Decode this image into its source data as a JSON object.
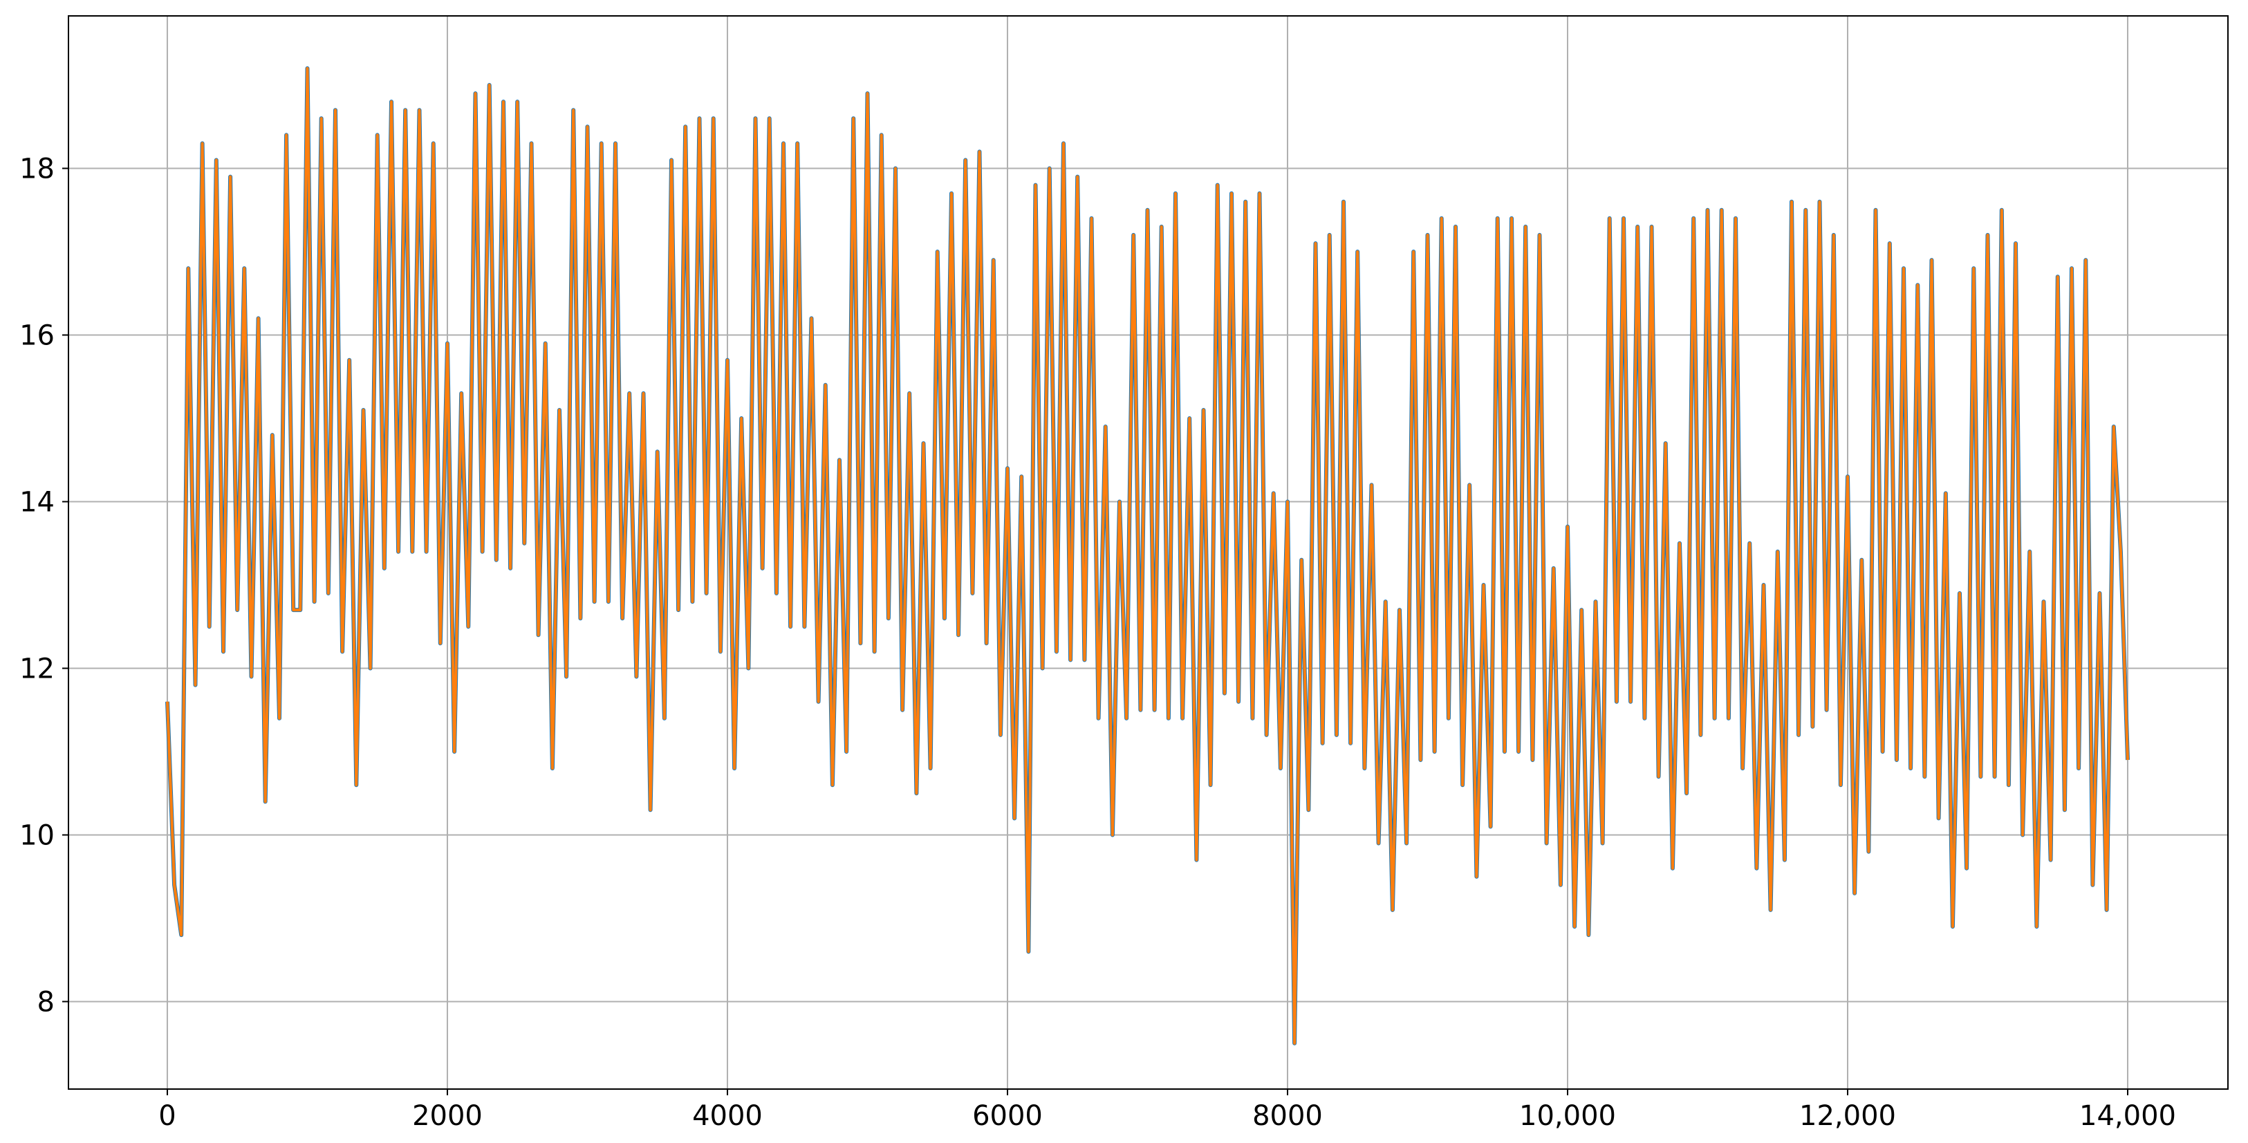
{
  "chart_data": {
    "type": "line",
    "title": "",
    "xlabel": "",
    "ylabel": "",
    "xlim": [
      -706,
      14716
    ],
    "ylim": [
      6.95,
      19.83
    ],
    "grid": true,
    "legend": "none",
    "x_start": 0,
    "x_step": 50,
    "x_ticks": [
      0,
      2000,
      4000,
      6000,
      8000,
      10000,
      12000,
      14000
    ],
    "x_tick_labels": [
      "0",
      "2000",
      "4000",
      "6000",
      "8000",
      "10,000",
      "12,000",
      "14,000"
    ],
    "y_ticks": [
      8,
      10,
      12,
      14,
      16,
      18
    ],
    "y_tick_labels": [
      "8",
      "10",
      "12",
      "14",
      "16",
      "18"
    ],
    "series": [
      {
        "name": "series-1",
        "color": "#1f77b4",
        "values": [
          11.6,
          9.4,
          8.8,
          16.8,
          11.8,
          18.3,
          12.5,
          18.1,
          12.2,
          17.9,
          12.7,
          16.8,
          11.9,
          16.2,
          10.4,
          14.8,
          11.4,
          18.4,
          12.7,
          12.7,
          19.2,
          12.8,
          18.6,
          12.9,
          18.7,
          12.2,
          15.7,
          10.6,
          15.1,
          12.0,
          18.4,
          13.2,
          18.8,
          13.4,
          18.7,
          13.4,
          18.7,
          13.4,
          18.3,
          12.3,
          15.9,
          11.0,
          15.3,
          12.5,
          18.9,
          13.4,
          19.0,
          13.3,
          18.8,
          13.2,
          18.8,
          13.5,
          18.3,
          12.4,
          15.9,
          10.8,
          15.1,
          11.9,
          18.7,
          12.6,
          18.5,
          12.8,
          18.3,
          12.8,
          18.3,
          12.6,
          15.3,
          11.9,
          15.3,
          10.3,
          14.6,
          11.4,
          18.1,
          12.7,
          18.5,
          12.8,
          18.6,
          12.9,
          18.6,
          12.2,
          15.7,
          10.8,
          15.0,
          12.0,
          18.6,
          13.2,
          18.6,
          12.9,
          18.3,
          12.5,
          18.3,
          12.5,
          16.2,
          11.6,
          15.4,
          10.6,
          14.5,
          11.0,
          18.6,
          12.3,
          18.9,
          12.2,
          18.4,
          12.6,
          18.0,
          11.5,
          15.3,
          10.5,
          14.7,
          10.8,
          17.0,
          12.6,
          17.7,
          12.4,
          18.1,
          12.9,
          18.2,
          12.3,
          16.9,
          11.2,
          14.4,
          10.2,
          14.3,
          8.6,
          17.8,
          12.0,
          18.0,
          12.2,
          18.3,
          12.1,
          17.9,
          12.1,
          17.4,
          11.4,
          14.9,
          10.0,
          14.0,
          11.4,
          17.2,
          11.5,
          17.5,
          11.5,
          17.3,
          11.4,
          17.7,
          11.4,
          15.0,
          9.7,
          15.1,
          10.6,
          17.8,
          11.7,
          17.7,
          11.6,
          17.6,
          11.4,
          17.7,
          11.2,
          14.1,
          10.8,
          14.0,
          7.5,
          13.3,
          10.3,
          17.1,
          11.1,
          17.2,
          11.2,
          17.6,
          11.1,
          17.0,
          10.8,
          14.2,
          9.9,
          12.8,
          9.1,
          12.7,
          9.9,
          17.0,
          10.9,
          17.2,
          11.0,
          17.4,
          11.4,
          17.3,
          10.6,
          14.2,
          9.5,
          13.0,
          10.1,
          17.4,
          11.0,
          17.4,
          11.0,
          17.3,
          10.9,
          17.2,
          9.9,
          13.2,
          9.4,
          13.7,
          8.9,
          12.7,
          8.8,
          12.8,
          9.9,
          17.4,
          11.6,
          17.4,
          11.6,
          17.3,
          11.4,
          17.3,
          10.7,
          14.7,
          9.6,
          13.5,
          10.5,
          17.4,
          11.2,
          17.5,
          11.4,
          17.5,
          11.4,
          17.4,
          10.8,
          13.5,
          9.6,
          13.0,
          9.1,
          13.4,
          9.7,
          17.6,
          11.2,
          17.5,
          11.3,
          17.6,
          11.5,
          17.2,
          10.6,
          14.3,
          9.3,
          13.3,
          9.8,
          17.5,
          11.0,
          17.1,
          10.9,
          16.8,
          10.8,
          16.6,
          10.7,
          16.9,
          10.2,
          14.1,
          8.9,
          12.9,
          9.6,
          16.8,
          10.7,
          17.2,
          10.7,
          17.5,
          10.6,
          17.1,
          10.0,
          13.4,
          8.9,
          12.8,
          9.7,
          16.7,
          10.3,
          16.8,
          10.8,
          16.9,
          9.4,
          12.9,
          9.1,
          14.9,
          13.4,
          10.9
        ]
      },
      {
        "name": "series-2",
        "color": "#ff7f0e",
        "values": [
          11.6,
          9.4,
          8.8,
          16.8,
          11.8,
          18.3,
          12.5,
          18.1,
          12.2,
          17.9,
          12.7,
          16.8,
          11.9,
          16.2,
          10.4,
          14.8,
          11.4,
          18.4,
          12.7,
          12.7,
          19.2,
          12.8,
          18.6,
          12.9,
          18.7,
          12.2,
          15.7,
          10.6,
          15.1,
          12.0,
          18.4,
          13.2,
          18.8,
          13.4,
          18.7,
          13.4,
          18.7,
          13.4,
          18.3,
          12.3,
          15.9,
          11.0,
          15.3,
          12.5,
          18.9,
          13.4,
          19.0,
          13.3,
          18.8,
          13.2,
          18.8,
          13.5,
          18.3,
          12.4,
          15.9,
          10.8,
          15.1,
          11.9,
          18.7,
          12.6,
          18.5,
          12.8,
          18.3,
          12.8,
          18.3,
          12.6,
          15.3,
          11.9,
          15.3,
          10.3,
          14.6,
          11.4,
          18.1,
          12.7,
          18.5,
          12.8,
          18.6,
          12.9,
          18.6,
          12.2,
          15.7,
          10.8,
          15.0,
          12.0,
          18.6,
          13.2,
          18.6,
          12.9,
          18.3,
          12.5,
          18.3,
          12.5,
          16.2,
          11.6,
          15.4,
          10.6,
          14.5,
          11.0,
          18.6,
          12.3,
          18.9,
          12.2,
          18.4,
          12.6,
          18.0,
          11.5,
          15.3,
          10.5,
          14.7,
          10.8,
          17.0,
          12.6,
          17.7,
          12.4,
          18.1,
          12.9,
          18.2,
          12.3,
          16.9,
          11.2,
          14.4,
          10.2,
          14.3,
          8.6,
          17.8,
          12.0,
          18.0,
          12.2,
          18.3,
          12.1,
          17.9,
          12.1,
          17.4,
          11.4,
          14.9,
          10.0,
          14.0,
          11.4,
          17.2,
          11.5,
          17.5,
          11.5,
          17.3,
          11.4,
          17.7,
          11.4,
          15.0,
          9.7,
          15.1,
          10.6,
          17.8,
          11.7,
          17.7,
          11.6,
          17.6,
          11.4,
          17.7,
          11.2,
          14.1,
          10.8,
          14.0,
          7.5,
          13.3,
          10.3,
          17.1,
          11.1,
          17.2,
          11.2,
          17.6,
          11.1,
          17.0,
          10.8,
          14.2,
          9.9,
          12.8,
          9.1,
          12.7,
          9.9,
          17.0,
          10.9,
          17.2,
          11.0,
          17.4,
          11.4,
          17.3,
          10.6,
          14.2,
          9.5,
          13.0,
          10.1,
          17.4,
          11.0,
          17.4,
          11.0,
          17.3,
          10.9,
          17.2,
          9.9,
          13.2,
          9.4,
          13.7,
          8.9,
          12.7,
          8.8,
          12.8,
          9.9,
          17.4,
          11.6,
          17.4,
          11.6,
          17.3,
          11.4,
          17.3,
          10.7,
          14.7,
          9.6,
          13.5,
          10.5,
          17.4,
          11.2,
          17.5,
          11.4,
          17.5,
          11.4,
          17.4,
          10.8,
          13.5,
          9.6,
          13.0,
          9.1,
          13.4,
          9.7,
          17.6,
          11.2,
          17.5,
          11.3,
          17.6,
          11.5,
          17.2,
          10.6,
          14.3,
          9.3,
          13.3,
          9.8,
          17.5,
          11.0,
          17.1,
          10.9,
          16.8,
          10.8,
          16.6,
          10.7,
          16.9,
          10.2,
          14.1,
          8.9,
          12.9,
          9.6,
          16.8,
          10.7,
          17.2,
          10.7,
          17.5,
          10.6,
          17.1,
          10.0,
          13.4,
          8.9,
          12.8,
          9.7,
          16.7,
          10.3,
          16.8,
          10.8,
          16.9,
          9.4,
          12.9,
          9.1,
          14.9,
          13.4,
          10.9
        ]
      }
    ]
  }
}
